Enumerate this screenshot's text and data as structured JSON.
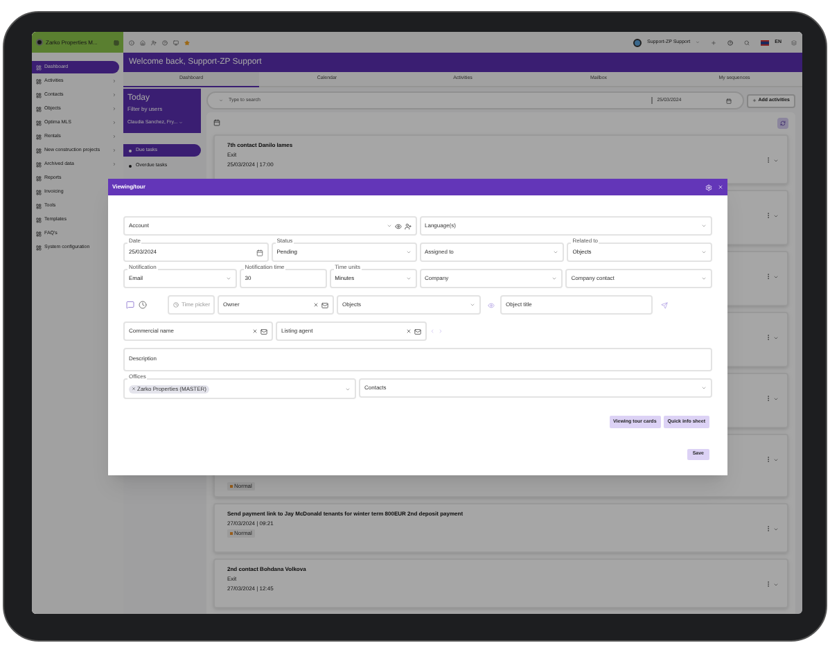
{
  "sidebar": {
    "brand": "Zarko Properties M...",
    "items": [
      {
        "label": "Dashboard",
        "selected": true,
        "expandable": false
      },
      {
        "label": "Activities",
        "selected": false,
        "expandable": true
      },
      {
        "label": "Contacts",
        "selected": false,
        "expandable": true
      },
      {
        "label": "Objects",
        "selected": false,
        "expandable": true
      },
      {
        "label": "Optima MLS",
        "selected": false,
        "expandable": true
      },
      {
        "label": "Rentals",
        "selected": false,
        "expandable": true
      },
      {
        "label": "New construction projects",
        "selected": false,
        "expandable": true
      },
      {
        "label": "Archived data",
        "selected": false,
        "expandable": true
      },
      {
        "label": "Reports",
        "selected": false,
        "expandable": false
      },
      {
        "label": "Invoicing",
        "selected": false,
        "expandable": false
      },
      {
        "label": "Tools",
        "selected": false,
        "expandable": false
      },
      {
        "label": "Templates",
        "selected": false,
        "expandable": false
      },
      {
        "label": "FAQ's",
        "selected": false,
        "expandable": false
      },
      {
        "label": "System configuration",
        "selected": false,
        "expandable": false
      }
    ]
  },
  "topbar": {
    "user": "Support-ZP Support",
    "language": "EN"
  },
  "welcome": "Welcome back, Support-ZP Support",
  "tabs": [
    {
      "label": "Dashboard",
      "selected": true
    },
    {
      "label": "Calendar",
      "selected": false
    },
    {
      "label": "Activities",
      "selected": false
    },
    {
      "label": "Mailbox",
      "selected": false
    },
    {
      "label": "My sequences",
      "selected": false
    }
  ],
  "today": {
    "title": "Today",
    "filter_label": "Filter by users",
    "users": "Claudia Sanchez, Fry..."
  },
  "search": {
    "placeholder": "Type to search",
    "date": "25/03/2024"
  },
  "add_button": "Add activities",
  "task_filters": [
    {
      "label": "Due tasks",
      "selected": true
    },
    {
      "label": "Overdue tasks",
      "selected": false
    }
  ],
  "tasks": [
    {
      "kind": "full",
      "title": "7th contact Danilo Iames",
      "subtitle": "Exit",
      "datetime": "25/03/2024 | 17:00"
    },
    {
      "kind": "covered"
    },
    {
      "kind": "covered"
    },
    {
      "kind": "covered"
    },
    {
      "kind": "covered"
    },
    {
      "kind": "covered",
      "tag": "Normal"
    },
    {
      "kind": "full",
      "title": "Send payment link to Jay McDonald tenants for winter term 800EUR 2nd deposit payment",
      "datetime": "27/03/2024 | 09:21",
      "tag": "Normal"
    },
    {
      "kind": "full",
      "title": "2nd contact Bohdana Volkova",
      "subtitle": "Exit",
      "datetime": "27/03/2024 | 12:45"
    }
  ],
  "modal": {
    "title": "Viewing/tour",
    "rows": [
      {
        "fields": [
          {
            "kind": "account",
            "placeholder": "Account"
          },
          {
            "kind": "select",
            "placeholder": "Language(s)"
          }
        ]
      },
      {
        "fields": [
          {
            "kind": "date",
            "label": "Date",
            "value": "25/03/2024"
          },
          {
            "kind": "select",
            "label": "Status",
            "value": "Pending"
          },
          {
            "kind": "select",
            "placeholder": "Assigned to"
          },
          {
            "kind": "select",
            "label": "Related to",
            "value": "Objects"
          }
        ]
      },
      {
        "fields": [
          {
            "kind": "select",
            "label": "Notification",
            "value": "Email"
          },
          {
            "kind": "text",
            "label": "Notification time",
            "value": "30"
          },
          {
            "kind": "select",
            "label": "Time units",
            "value": "Minutes"
          },
          {
            "kind": "select",
            "placeholder": "Company"
          },
          {
            "kind": "select",
            "placeholder": "Company contact"
          }
        ]
      },
      {
        "fields": [
          {
            "kind": "tools"
          },
          {
            "kind": "time",
            "placeholder": "Time picker"
          },
          {
            "kind": "lookup",
            "placeholder": "Owner"
          },
          {
            "kind": "select",
            "placeholder": "Objects"
          },
          {
            "kind": "eye"
          },
          {
            "kind": "text",
            "placeholder": "Object title"
          },
          {
            "kind": "send"
          }
        ]
      },
      {
        "fields": [
          {
            "kind": "lookup",
            "placeholder": "Commercial name"
          },
          {
            "kind": "lookup",
            "placeholder": "Listing agent"
          },
          {
            "kind": "arrows"
          }
        ]
      },
      {
        "fields": [
          {
            "kind": "textarea",
            "placeholder": "Description"
          }
        ]
      },
      {
        "fields": [
          {
            "kind": "chips",
            "label": "Offices",
            "chips": [
              "Zarko Properties (MASTER)"
            ]
          },
          {
            "kind": "select",
            "placeholder": "Contacts"
          }
        ]
      }
    ],
    "actions": [
      "Viewing tour cards",
      "Quick info sheet"
    ],
    "save": "Save"
  }
}
